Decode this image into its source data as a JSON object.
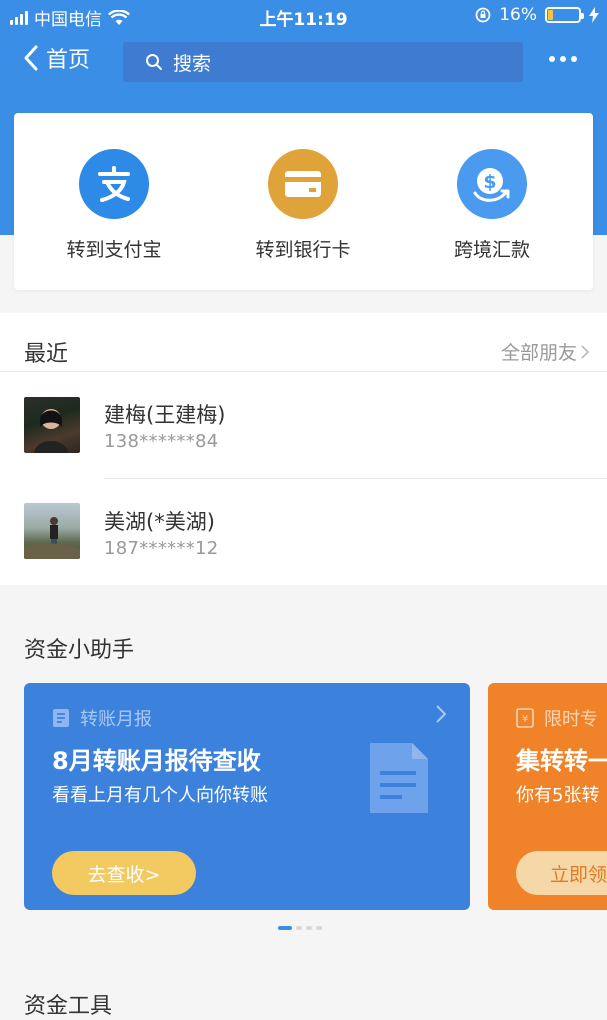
{
  "status_bar": {
    "carrier": "中国电信",
    "time": "上午11:19",
    "battery": "16%"
  },
  "nav": {
    "back_label": "首页",
    "search_placeholder": "搜索"
  },
  "transfer_options": [
    {
      "label": "转到支付宝",
      "icon": "alipay-icon",
      "color": "#2d8ae6"
    },
    {
      "label": "转到银行卡",
      "icon": "bank-card-icon",
      "color": "#e0a33a"
    },
    {
      "label": "跨境汇款",
      "icon": "cross-border-remit-icon",
      "color": "#4a9af0"
    }
  ],
  "recent": {
    "title": "最近",
    "all_friends": "全部朋友",
    "contacts": [
      {
        "name": "建梅(王建梅)",
        "phone": "138******84"
      },
      {
        "name": "美湖(*美湖)",
        "phone": "187******12"
      }
    ]
  },
  "assistant": {
    "title": "资金小助手",
    "cards": [
      {
        "tag": "转账月报",
        "headline": "8月转账月报待查收",
        "sub": "看看上月有几个人向你转账",
        "button": "去查收>",
        "color": "#3c82dd"
      },
      {
        "tag": "限时专",
        "headline": "集转转一",
        "sub": "你有5张转",
        "button": "立即领耳",
        "color": "#f0832a"
      }
    ]
  },
  "tools": {
    "title": "资金工具"
  },
  "colors": {
    "brand_blue": "#3a8ee6",
    "orange": "#f0832a",
    "gold": "#f3c961"
  }
}
